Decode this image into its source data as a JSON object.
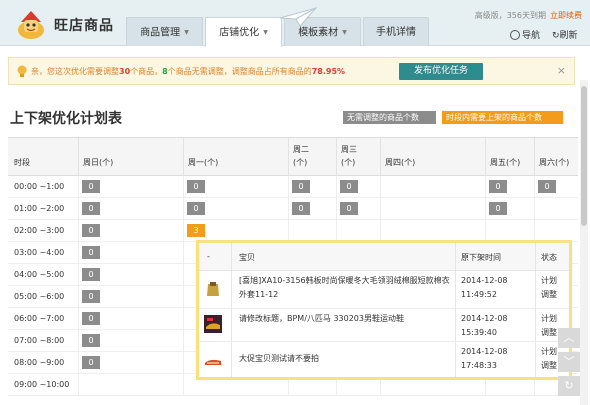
{
  "app": {
    "logo_text": "旺店商品",
    "version_text": "高级版，356天到期",
    "renew_label": "立即续费",
    "guide_label": "导航",
    "refresh_label": "刷新"
  },
  "tabs": [
    {
      "label": "商品管理",
      "caret": "▼"
    },
    {
      "label": "店铺优化",
      "caret": "▼"
    },
    {
      "label": "模板素材",
      "caret": "▼"
    },
    {
      "label": "手机详情",
      "caret": ""
    }
  ],
  "notice": {
    "prefix": "亲，您这次优化需要调整",
    "count_adjust": "30",
    "mid1": "个商品，",
    "count_ok": "8",
    "mid2": "个商品无需调整，调整商品占所有商品的",
    "percent": "78.95%",
    "button": "发布优化任务",
    "close": "×"
  },
  "page": {
    "title": "上下架优化计划表",
    "legend_gray": "无需调整的商品个数",
    "legend_orange": "时段内需要上架的商品个数"
  },
  "table": {
    "headers": [
      "时段",
      "周日(个)",
      "周一(个)",
      "周二(个)",
      "周三(个)",
      "周四(个)",
      "周五(个)",
      "周六(个)"
    ],
    "rows": [
      {
        "label": "00:00 ~1:00",
        "cells": [
          "0",
          "0",
          "0",
          "0",
          "",
          "0",
          "0"
        ]
      },
      {
        "label": "01:00 ~2:00",
        "cells": [
          "0",
          "0",
          "0",
          "0",
          "",
          "0",
          ""
        ]
      },
      {
        "label": "02:00 ~3:00",
        "cells": [
          "0",
          "3",
          "",
          "",
          "",
          "",
          ""
        ]
      },
      {
        "label": "03:00 ~4:00",
        "cells": [
          "0",
          "",
          "",
          "",
          "",
          "",
          ""
        ]
      },
      {
        "label": "04:00 ~5:00",
        "cells": [
          "0",
          "",
          "",
          "",
          "",
          "",
          ""
        ]
      },
      {
        "label": "05:00 ~6:00",
        "cells": [
          "0",
          "",
          "",
          "",
          "",
          "",
          ""
        ]
      },
      {
        "label": "06:00 ~7:00",
        "cells": [
          "0",
          "",
          "",
          "",
          "",
          "",
          ""
        ]
      },
      {
        "label": "07:00 ~8:00",
        "cells": [
          "0",
          "",
          "",
          "",
          "",
          "",
          ""
        ]
      },
      {
        "label": "08:00 ~9:00",
        "cells": [
          "0",
          "",
          "",
          "",
          "",
          "",
          ""
        ]
      },
      {
        "label": "09:00 ~10:00",
        "cells": [
          "",
          "",
          "",
          "",
          "",
          "",
          ""
        ]
      }
    ]
  },
  "popup": {
    "headers": {
      "dot": "-",
      "item": "宝贝",
      "time": "原下架时间",
      "status": "状态"
    },
    "rows": [
      {
        "name": "[喜旭]XA10-3156韩板时尚保暖冬大毛领羽绒棉服短款棉衣外套11-12",
        "date": "2014-12-08",
        "time": "11:49:52",
        "status": "计划调整"
      },
      {
        "name": "请修改标题，BPM/八匹马 330203男鞋运动鞋",
        "date": "2014-12-08",
        "time": "15:39:40",
        "status": "计划调整"
      },
      {
        "name": "大促宝贝测试请不要拍",
        "date": "2014-12-08",
        "time": "17:48:33",
        "status": "计划调整"
      }
    ]
  },
  "side_tools": {
    "up": "︿",
    "down": "﹀",
    "refresh": "↻"
  },
  "colors": {
    "gray_chip": "#8c8c8c",
    "orange_chip": "#f39c1b",
    "publish_button": "#2e8b8e",
    "popup_border": "#f8e27d"
  }
}
